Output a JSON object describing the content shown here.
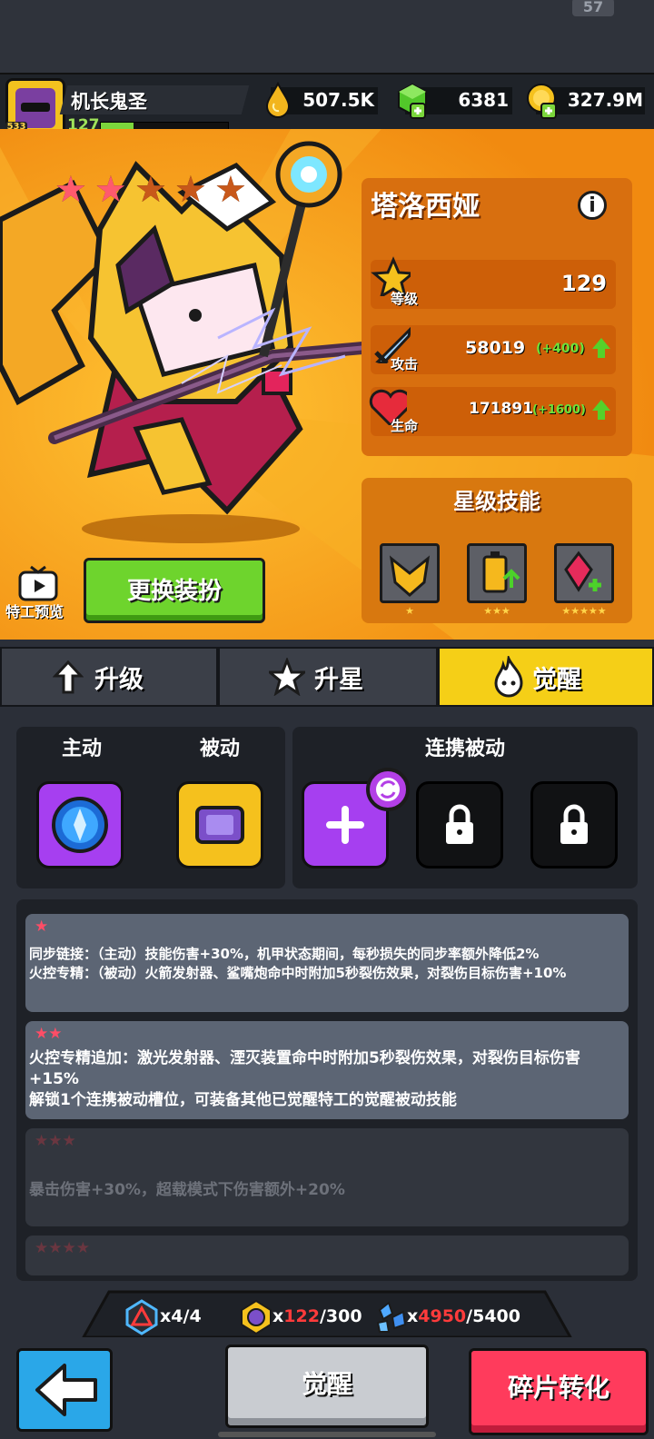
{
  "status": {
    "badge": "57"
  },
  "player": {
    "name": "机长鬼圣",
    "level": "127",
    "avatar_level": "533",
    "xp_fraction": 0.26
  },
  "resources": {
    "gold": "507.5K",
    "gems": "6381",
    "coins": "327.9M"
  },
  "hero": {
    "name": "塔洛西娅",
    "stars_filled": 2,
    "stats": [
      {
        "label": "等级",
        "value": "129",
        "bonus": ""
      },
      {
        "label": "攻击",
        "value": "58019",
        "bonus": "(+400)"
      },
      {
        "label": "生命",
        "value": "171891",
        "bonus": "(+1600)"
      }
    ],
    "star_skills_title": "星级技能",
    "star_skills": [
      {
        "icon": "golden-mask-icon",
        "stars": "★"
      },
      {
        "icon": "battery-upgrade-icon",
        "stars": "★★★"
      },
      {
        "icon": "red-crystal-plus-icon",
        "stars": "★★★★★"
      }
    ],
    "preview_label": "特工预览",
    "change_outfit": "更换装扮"
  },
  "tabs": [
    {
      "label": "升级",
      "icon": "arrow-up-icon"
    },
    {
      "label": "升星",
      "icon": "star-icon"
    },
    {
      "label": "觉醒",
      "icon": "flame-icon"
    }
  ],
  "awaken": {
    "active_label": "主动",
    "passive_label": "被动",
    "linked_label": "连携被动"
  },
  "descriptions": [
    {
      "stars": "★",
      "text": "同步链接：（主动）技能伤害+30%，机甲状态期间，每秒损失的同步率额外降低2%\n火控专精：（被动）火箭发射器、鲨嘴炮命中时附加5秒裂伤效果，对裂伤目标伤害+10%",
      "locked": false
    },
    {
      "stars": "★★",
      "text": "火控专精追加：激光发射器、湮灭装置命中时附加5秒裂伤效果，对裂伤目标伤害+15%\n解锁1个连携被动槽位，可装备其他已觉醒特工的觉醒被动技能",
      "locked": false
    },
    {
      "stars": "★★★",
      "text": "暴击伤害+30%，超载模式下伤害额外+20%",
      "locked": true
    },
    {
      "stars": "★★★★",
      "text": "",
      "locked": true
    }
  ],
  "costs": {
    "a_prefix": "x",
    "a_have": "4",
    "a_need": "/4",
    "b_prefix": "x",
    "b_have": "122",
    "b_need": "/300",
    "c_prefix": "x",
    "c_have": "4950",
    "c_need": "/5400"
  },
  "buttons": {
    "awaken": "觉醒",
    "convert": "碎片转化"
  }
}
